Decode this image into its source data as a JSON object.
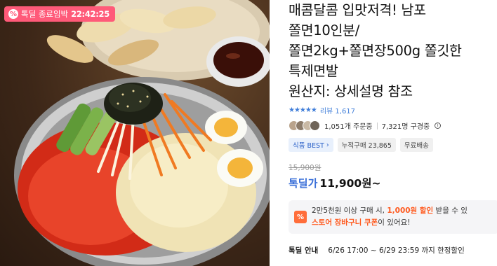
{
  "deal_badge": {
    "icon": "percent-icon",
    "label": "톡딜 종료임박",
    "time": "22:42:25",
    "color": "#ff5a79"
  },
  "product": {
    "title_lines": [
      "매콤달콤 입맛저격! 남포",
      "쫄면10인분/",
      "쫄면2kg+쫄면장500g 쫄깃한",
      "특제면발",
      "원산지: 상세설명 참조"
    ],
    "stars": "★★★★★",
    "review_link": "리뷰 1,617",
    "orders": "1,051개 주문중",
    "watching": "7,321명 구경중",
    "tags": [
      {
        "label": "식품 BEST",
        "icon": "chevron-right-icon",
        "style": "blue"
      },
      {
        "label": "누적구매 23,865",
        "style": "gray"
      },
      {
        "label": "무료배송",
        "style": "gray"
      }
    ],
    "original_price": "15,900원",
    "sale_label": "톡딜가",
    "sale_price": "11,900원~"
  },
  "coupon": {
    "icon": "coupon-percent-icon",
    "line1_prefix": "2만5천원 이상 구매 시, ",
    "line1_highlight": "1,000원 할인",
    "line1_suffix": " 받을 수 있",
    "line2_highlight": "스토어 장바구니 쿠폰",
    "line2_suffix": "이 있어요!"
  },
  "deal_info": {
    "label": "톡딜 안내",
    "text": "6/26 17:00 ~ 6/29 23:59 까지 한정할인"
  },
  "colors": {
    "accent_blue": "#3f7dd9",
    "coupon_orange": "#ff5a1f",
    "badge_pink": "#ff5a79"
  }
}
